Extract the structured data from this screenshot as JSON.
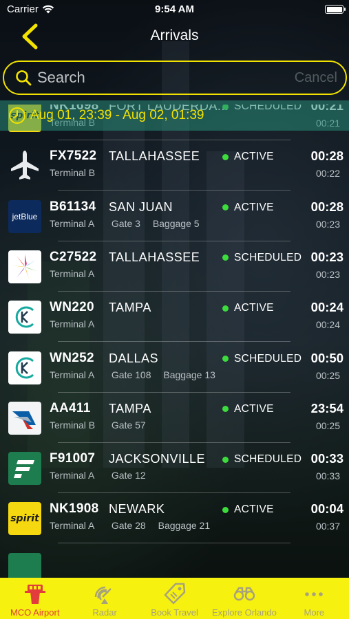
{
  "status_bar": {
    "carrier": "Carrier",
    "time": "9:54 AM"
  },
  "nav": {
    "title": "Arrivals"
  },
  "search": {
    "placeholder": "Search",
    "cancel_label": "Cancel"
  },
  "date_range": "Aug 01, 23:39 - Aug 02, 01:39",
  "flights": [
    {
      "logo": "spirit",
      "flight": "NK1698",
      "city": "FORT LAUDERDA...",
      "terminal": "Terminal B",
      "gate": "",
      "baggage": "",
      "status": "SCHEDULED",
      "time_primary": "00:21",
      "time_secondary": "00:21"
    },
    {
      "logo": "plane",
      "flight": "FX7522",
      "city": "TALLAHASSEE",
      "terminal": "Terminal B",
      "gate": "",
      "baggage": "",
      "status": "ACTIVE",
      "time_primary": "00:28",
      "time_secondary": "00:22"
    },
    {
      "logo": "jetblue",
      "flight": "B61134",
      "city": "SAN JUAN",
      "terminal": "Terminal A",
      "gate": "Gate 3",
      "baggage": "Baggage 5",
      "status": "ACTIVE",
      "time_primary": "00:28",
      "time_secondary": "00:23"
    },
    {
      "logo": "silver",
      "flight": "C27522",
      "city": "TALLAHASSEE",
      "terminal": "Terminal A",
      "gate": "",
      "baggage": "",
      "status": "SCHEDULED",
      "time_primary": "00:23",
      "time_secondary": "00:23"
    },
    {
      "logo": "k",
      "flight": "WN220",
      "city": "TAMPA",
      "terminal": "Terminal A",
      "gate": "",
      "baggage": "",
      "status": "ACTIVE",
      "time_primary": "00:24",
      "time_secondary": "00:24"
    },
    {
      "logo": "k",
      "flight": "WN252",
      "city": "DALLAS",
      "terminal": "Terminal A",
      "gate": "Gate 108",
      "baggage": "Baggage 13",
      "status": "SCHEDULED",
      "time_primary": "00:50",
      "time_secondary": "00:25"
    },
    {
      "logo": "american",
      "flight": "AA411",
      "city": "TAMPA",
      "terminal": "Terminal B",
      "gate": "Gate 57",
      "baggage": "",
      "status": "ACTIVE",
      "time_primary": "23:54",
      "time_secondary": "00:25"
    },
    {
      "logo": "frontier",
      "flight": "F91007",
      "city": "JACKSONVILLE",
      "terminal": "Terminal A",
      "gate": "Gate 12",
      "baggage": "",
      "status": "SCHEDULED",
      "time_primary": "00:33",
      "time_secondary": "00:33"
    },
    {
      "logo": "spirit",
      "flight": "NK1908",
      "city": "NEWARK",
      "terminal": "Terminal A",
      "gate": "Gate 28",
      "baggage": "Baggage 21",
      "status": "ACTIVE",
      "time_primary": "00:04",
      "time_secondary": "00:37"
    }
  ],
  "logo_texts": {
    "spirit": "spirit",
    "jetblue": "jetBlue"
  },
  "tabs": [
    {
      "label": "MCO Airport",
      "icon": "tower-icon",
      "active": true
    },
    {
      "label": "Radar",
      "icon": "radar-icon",
      "active": false
    },
    {
      "label": "Book Travel",
      "icon": "tag-icon",
      "active": false
    },
    {
      "label": "Explore Orlando",
      "icon": "binoculars-icon",
      "active": false
    },
    {
      "label": "More",
      "icon": "more-icon",
      "active": false
    }
  ],
  "colors": {
    "accent": "#f2e200",
    "tabbar": "#f6f10f",
    "active_dot": "#3ddc3d",
    "active_tab": "#e23c3c"
  }
}
